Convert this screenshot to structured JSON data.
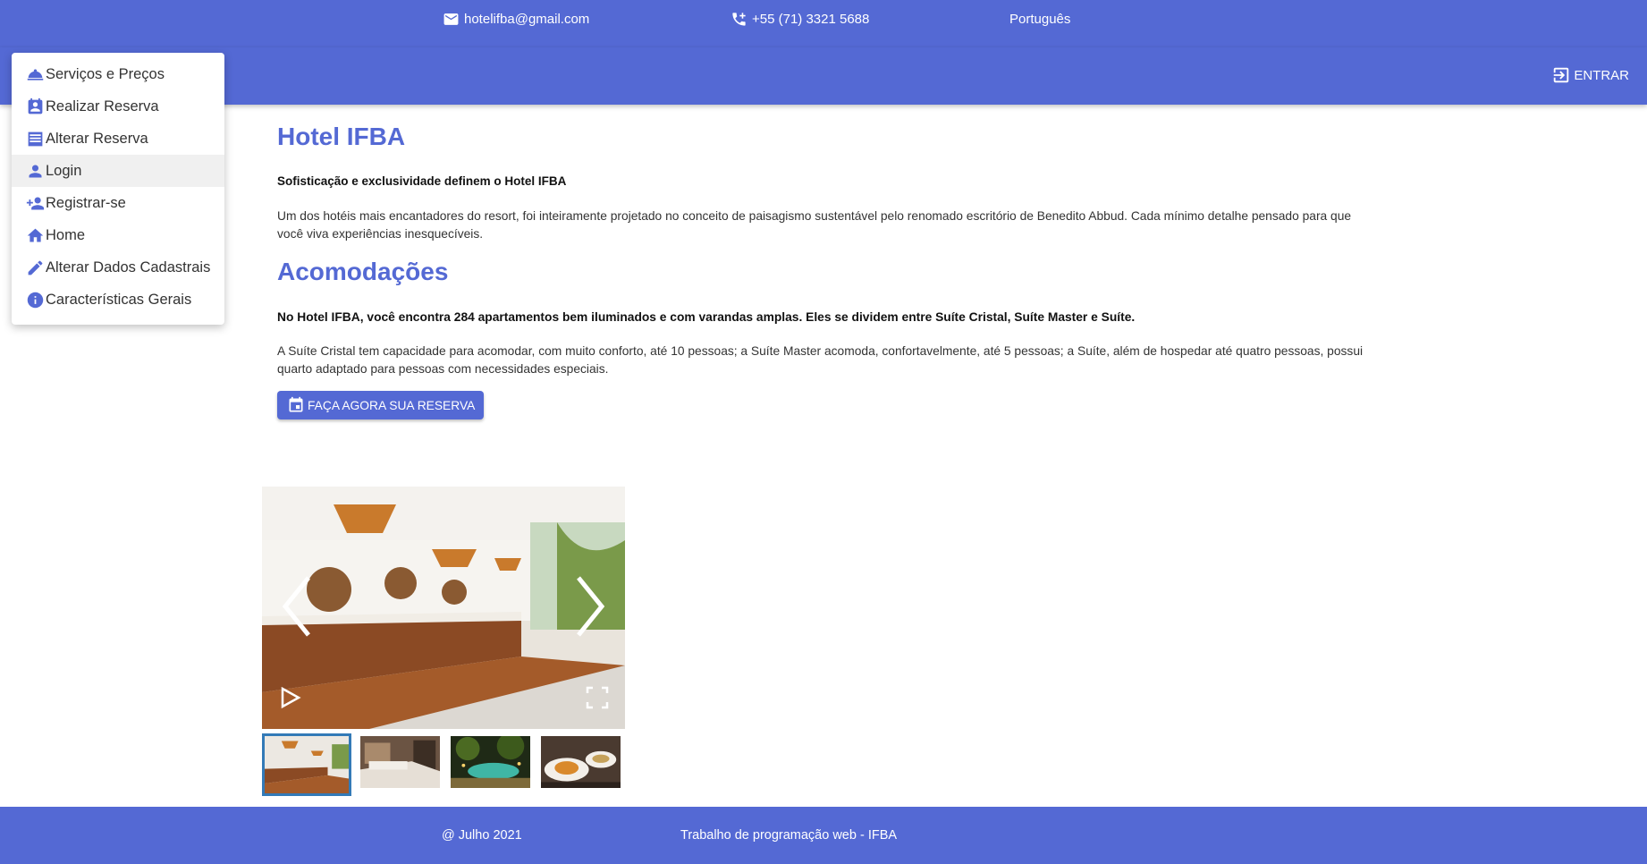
{
  "topbar": {
    "email": "hotelifba@gmail.com",
    "phone": "+55 (71) 3321 5688",
    "language": "Português",
    "background": "#5469d4"
  },
  "appbar": {
    "login_label": "ENTRAR"
  },
  "menu": {
    "items": [
      {
        "label": "Serviços e Preços",
        "icon": "room-service-icon"
      },
      {
        "label": "Realizar Reserva",
        "icon": "contact-calendar-icon"
      },
      {
        "label": "Alterar Reserva",
        "icon": "list-alt-icon"
      },
      {
        "label": "Login",
        "icon": "person-icon"
      },
      {
        "label": "Registrar-se",
        "icon": "person-add-icon"
      },
      {
        "label": "Home",
        "icon": "home-icon"
      },
      {
        "label": "Alterar Dados Cadastrais",
        "icon": "edit-icon"
      },
      {
        "label": "Características Gerais",
        "icon": "info-icon"
      }
    ]
  },
  "main": {
    "title": "Hotel IFBA",
    "lead": "Sofisticação e exclusividade definem o Hotel IFBA",
    "intro": "Um dos hotéis mais encantadores do resort, foi inteiramente projetado no conceito de paisagismo sustentável pelo renomado escritório de Benedito Abbud. Cada mínimo detalhe pensado para que você viva experiências inesquecíveis.",
    "section_title": "Acomodações",
    "section_lead": "No Hotel IFBA, você encontra 284 apartamentos bem iluminados e com varandas amplas. Eles se dividem entre Suíte Cristal, Suíte Master e Suíte.",
    "section_text": "A Suíte Cristal tem capacidade para acomodar, com muito conforto, até 10 pessoas; a Suíte Master acomoda, confortavelmente, até 5 pessoas; a Suíte, além de hospedar até quatro pessoas, possui quarto adaptado para pessoas com necessidades especiais.",
    "reserve_button": "FAÇA AGORA SUA RESERVA"
  },
  "gallery": {
    "thumbnails": [
      "lobby-photo",
      "bedroom-photo",
      "pool-night-photo",
      "food-photo"
    ],
    "active_index": 0
  },
  "footer": {
    "date": "@ Julho 2021",
    "credit": "Trabalho de programação web - IFBA"
  },
  "colors": {
    "primary": "#5469d4",
    "thumb_active_border": "#337ab7"
  }
}
